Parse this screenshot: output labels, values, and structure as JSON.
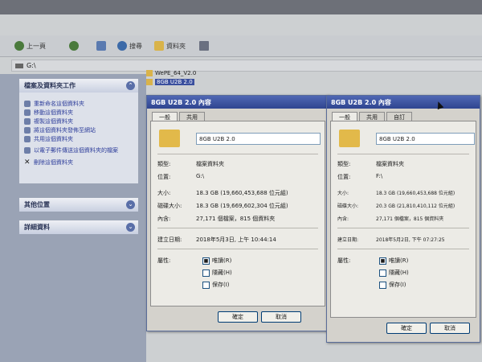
{
  "toolbar": {
    "back_label": "上一頁",
    "search_label": "搜尋",
    "folders_label": "資料夾"
  },
  "address": {
    "value": "G:\\"
  },
  "sidebar": {
    "tasks_title": "檔案及資料夾工作",
    "tasks": [
      "重新命名這個資料夾",
      "移動這個資料夾",
      "複製這個資料夾",
      "將這個資料夾發佈至網站",
      "共用這個資料夾",
      "以電子郵件傳送這個資料夾的檔案",
      "刪除這個資料夾"
    ],
    "other_places": "其他位置",
    "details": "詳細資料"
  },
  "folder_list": [
    "WePE_64_V2.0",
    "8GB U2B 2.0"
  ],
  "dialog1": {
    "title": "8GB U2B 2.0 內容",
    "tabs": [
      "一般",
      "共用"
    ],
    "name": "8GB U2B 2.0",
    "rows": [
      {
        "label": "類型:",
        "value": "檔案資料夾"
      },
      {
        "label": "位置:",
        "value": "G:\\"
      },
      {
        "label": "大小:",
        "value": "18.3 GB (19,660,453,688 位元組)"
      },
      {
        "label": "磁碟大小:",
        "value": "18.3 GB (19,669,602,304 位元組)"
      },
      {
        "label": "內含:",
        "value": "27,171 個檔案，815 個資料夾"
      },
      {
        "label": "建立日期:",
        "value": "2018年5月3日, 上午 10:44:14"
      }
    ],
    "attributes_label": "屬性:",
    "attributes": [
      "唯讀(R)",
      "隱藏(H)",
      "保存(I)"
    ],
    "ok": "確定",
    "cancel": "取消"
  },
  "dialog2": {
    "title": "8GB U2B 2.0 內容",
    "tabs": [
      "一般",
      "共用",
      "自訂"
    ],
    "name": "8GB U2B 2.0",
    "rows": [
      {
        "label": "類型:",
        "value": "檔案資料夾"
      },
      {
        "label": "位置:",
        "value": "F:\\"
      },
      {
        "label": "大小:",
        "value": "18.3 GB (19,660,453,688 位元組)"
      },
      {
        "label": "磁碟大小:",
        "value": "20.3 GB (21,810,410,112 位元組)"
      },
      {
        "label": "內含:",
        "value": "27,171 個檔案，815 個資料夾"
      },
      {
        "label": "建立日期:",
        "value": "2018年5月2日, 下午 07:27:25"
      }
    ],
    "attributes_label": "屬性:",
    "attributes": [
      "唯讀(R)",
      "隱藏(H)",
      "保存(I)"
    ],
    "ok": "確定",
    "cancel": "取消"
  }
}
